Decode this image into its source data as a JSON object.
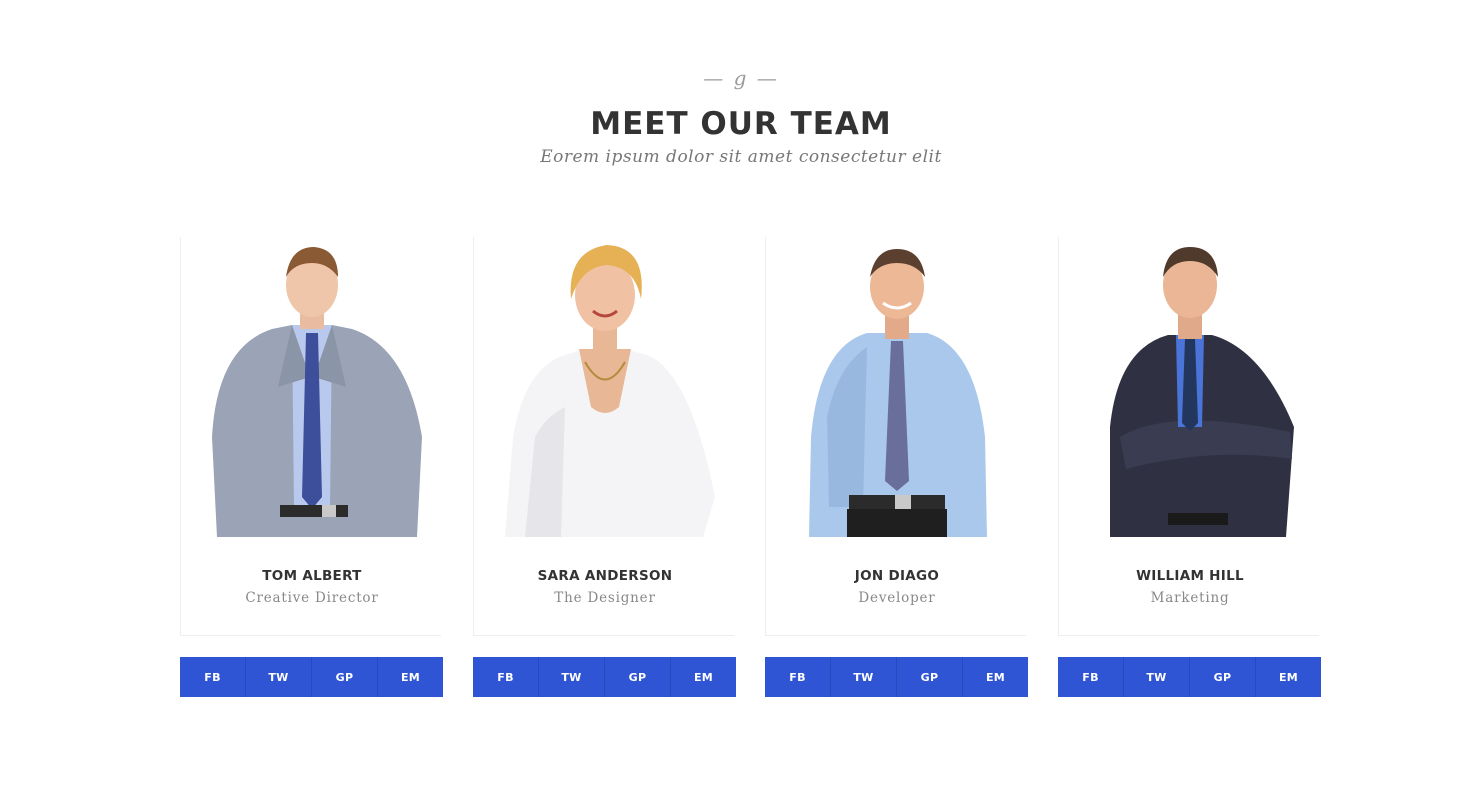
{
  "section": {
    "ornament": "— g —",
    "title": "MEET OUR TEAM",
    "subtitle": "Eorem ipsum dolor sit amet consectetur elit"
  },
  "team": [
    {
      "name": "TOM ALBERT",
      "role": "Creative Director",
      "photo": "man-grey-suit-photo",
      "social": [
        "FB",
        "TW",
        "GP",
        "EM"
      ]
    },
    {
      "name": "SARA ANDERSON",
      "role": "The Designer",
      "photo": "woman-white-blouse-photo",
      "social": [
        "FB",
        "TW",
        "GP",
        "EM"
      ]
    },
    {
      "name": "JON DIAGO",
      "role": "Developer",
      "photo": "man-blue-shirt-photo",
      "social": [
        "FB",
        "TW",
        "GP",
        "EM"
      ]
    },
    {
      "name": "WILLIAM HILL",
      "role": "Marketing",
      "photo": "man-dark-suit-photo",
      "social": [
        "FB",
        "TW",
        "GP",
        "EM"
      ]
    }
  ],
  "colors": {
    "accent": "#2f55d4",
    "heading": "#333333",
    "muted": "#888888"
  }
}
